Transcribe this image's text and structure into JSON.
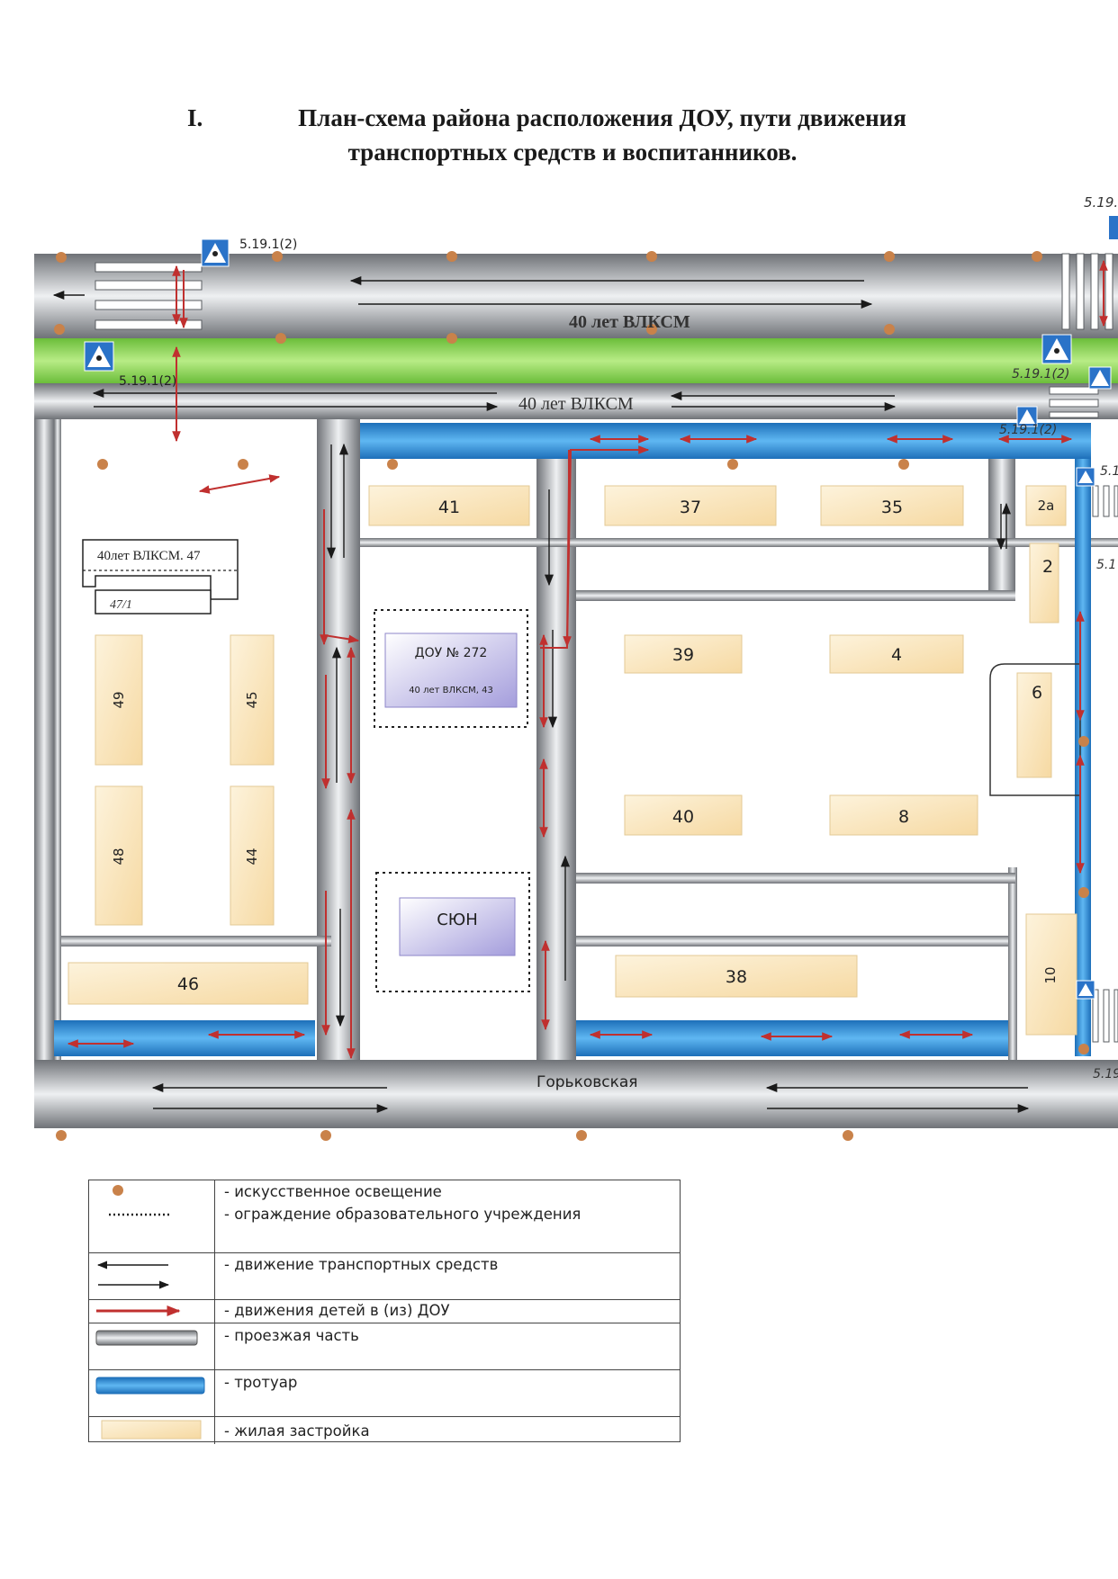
{
  "header": {
    "roman": "I.",
    "line1": "План-схема района расположения ДОУ, пути движения",
    "line2": "транспортных средств и воспитанников."
  },
  "streets": {
    "north_main": "40 лет ВЛКСМ",
    "north_service": "40 лет ВЛКСМ",
    "south": "Горьковская"
  },
  "signs": {
    "top_left": "5.19.1(2)",
    "green_left": "5.19.1(2)",
    "top_right_corner": "5.19.",
    "green_right": "5.19.1(2)",
    "service_right": "5.19.1(2)",
    "right_side_1": "5.1",
    "right_side_2": "5.1",
    "bottom_right": "5.19"
  },
  "buildings": {
    "b41": "41",
    "b37": "37",
    "b35": "35",
    "b2a": "2а",
    "b2": "2",
    "b39": "39",
    "b4": "4",
    "b6": "6",
    "b40": "40",
    "b8": "8",
    "b38": "38",
    "b10": "10",
    "b46": "46",
    "b49": "49",
    "b45": "45",
    "b48": "48",
    "b44": "44",
    "b47_label": "40лет ВЛКСМ. 47",
    "b47_1_label": "47/1"
  },
  "institutions": {
    "dou_name": "ДОУ  № 272",
    "dou_address": "40 лет ВЛКСМ, 43",
    "syun": "СЮН"
  },
  "legend": {
    "items": [
      {
        "symbol": "lamp",
        "label": "- искусственное освещение"
      },
      {
        "symbol": "dotted-fence",
        "label": "- ограждение образовательного учреждения"
      },
      {
        "symbol": "vehicle-arrows",
        "label": "- движение транспортных средств"
      },
      {
        "symbol": "children-arrow",
        "label": "- движения детей в (из) ДОУ"
      },
      {
        "symbol": "road-bar",
        "label": "- проезжая часть"
      },
      {
        "symbol": "sidewalk-bar",
        "label": "- тротуар"
      },
      {
        "symbol": "housing-bar",
        "label": "- жилая застройка"
      }
    ]
  },
  "colors": {
    "lamp": "#c9824a",
    "road": "#a9abb0",
    "sidewalk": "#2f8fd8",
    "green_strip": "#8cd14f",
    "housing": "#fbe4b8",
    "institution": "#b9b3e3",
    "child_arrow": "#c0302f",
    "vehicle_arrow": "#1a1a1a",
    "sign": "#2a73c8"
  }
}
